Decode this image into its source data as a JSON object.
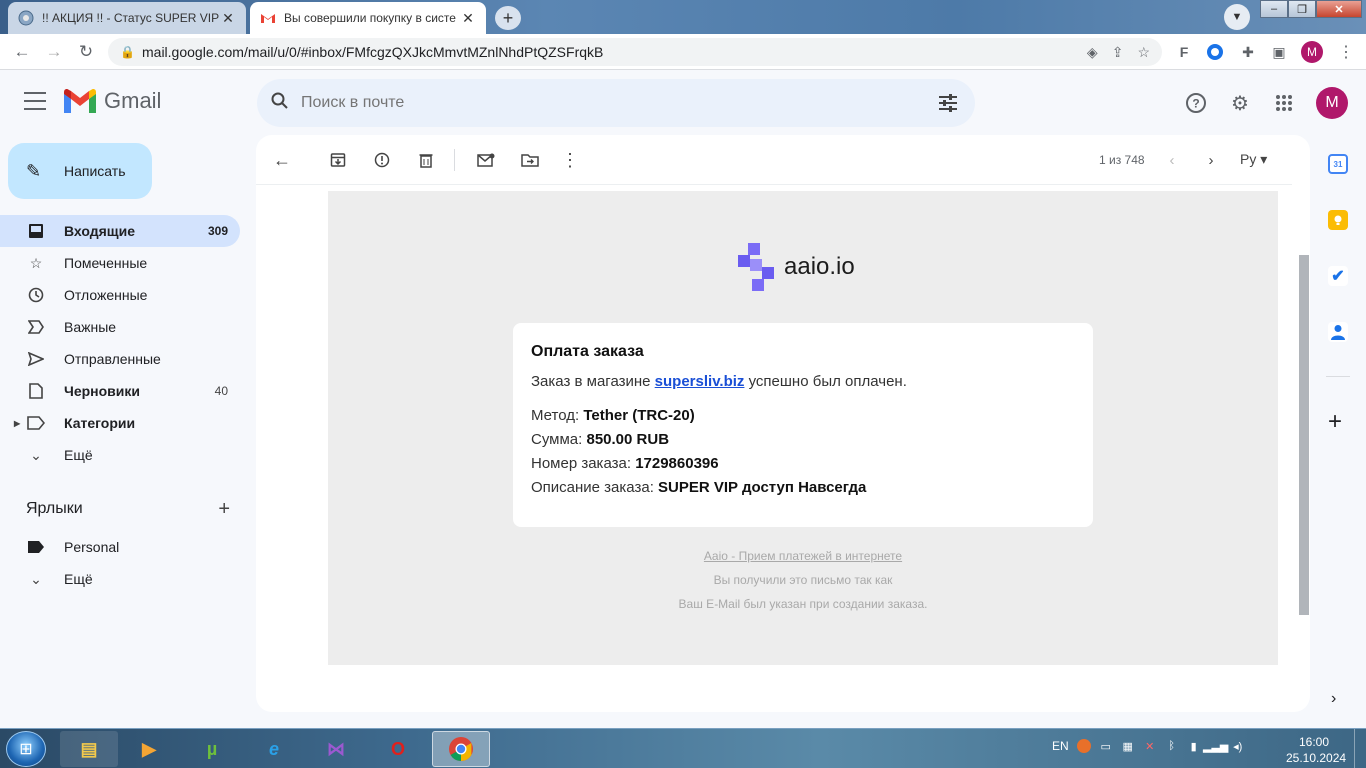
{
  "browser": {
    "tabs": [
      {
        "title": "!! АКЦИЯ !! - Статус SUPER VIP с",
        "active": false
      },
      {
        "title": "Вы совершили покупку в систе",
        "active": true
      }
    ],
    "url": "mail.google.com/mail/u/0/#inbox/FMfcgzQXJkcMmvtMZnlNhdPtQZSFrqkB",
    "profile_initial": "M"
  },
  "gmail": {
    "product": "Gmail",
    "search_placeholder": "Поиск в почте",
    "avatar_initial": "M",
    "compose_label": "Написать",
    "nav": [
      {
        "label": "Входящие",
        "count": "309",
        "icon": "inbox-icon"
      },
      {
        "label": "Помеченные",
        "count": "",
        "icon": "star-icon"
      },
      {
        "label": "Отложенные",
        "count": "",
        "icon": "clock-icon"
      },
      {
        "label": "Важные",
        "count": "",
        "icon": "important-icon"
      },
      {
        "label": "Отправленные",
        "count": "",
        "icon": "send-icon"
      },
      {
        "label": "Черновики",
        "count": "40",
        "icon": "draft-icon"
      },
      {
        "label": "Категории",
        "count": "",
        "icon": "label-outline-icon"
      },
      {
        "label": "Ещё",
        "count": "",
        "icon": "chevron-down-icon"
      }
    ],
    "labels_title": "Ярлыки",
    "labels": [
      {
        "label": "Personal",
        "icon": "label-icon"
      },
      {
        "label": "Ещё",
        "icon": "chevron-down-icon"
      }
    ],
    "pager": "1 из 748",
    "input_lang": "Ру"
  },
  "email": {
    "brand": "aaio.io",
    "heading": "Оплата заказа",
    "intro_before": "Заказ в магазине ",
    "store_link": "supersliv.biz",
    "intro_after": " успешно был оплачен.",
    "details": [
      {
        "key": "Метод:",
        "value": "Tether (TRC-20)"
      },
      {
        "key": "Сумма:",
        "value": "850.00 RUB"
      },
      {
        "key": "Номер заказа:",
        "value": "1729860396"
      },
      {
        "key": "Описание заказа:",
        "value": "SUPER VIP доступ Навсегда"
      }
    ],
    "footer_link": "Aaio - Прием платежей в интернете",
    "footer_line1": "Вы получили это письмо так как",
    "footer_line2": "Ваш E-Mail был указан при создании заказа."
  },
  "taskbar": {
    "lang": "EN",
    "time": "16:00",
    "date": "25.10.2024"
  },
  "colors": {
    "gmail_red": "#ea4335",
    "selected_nav": "#d3e3fd",
    "compose_bg": "#c2e7ff",
    "link_blue": "#1a4fd6",
    "brand_purple": "#7b6cf6"
  }
}
